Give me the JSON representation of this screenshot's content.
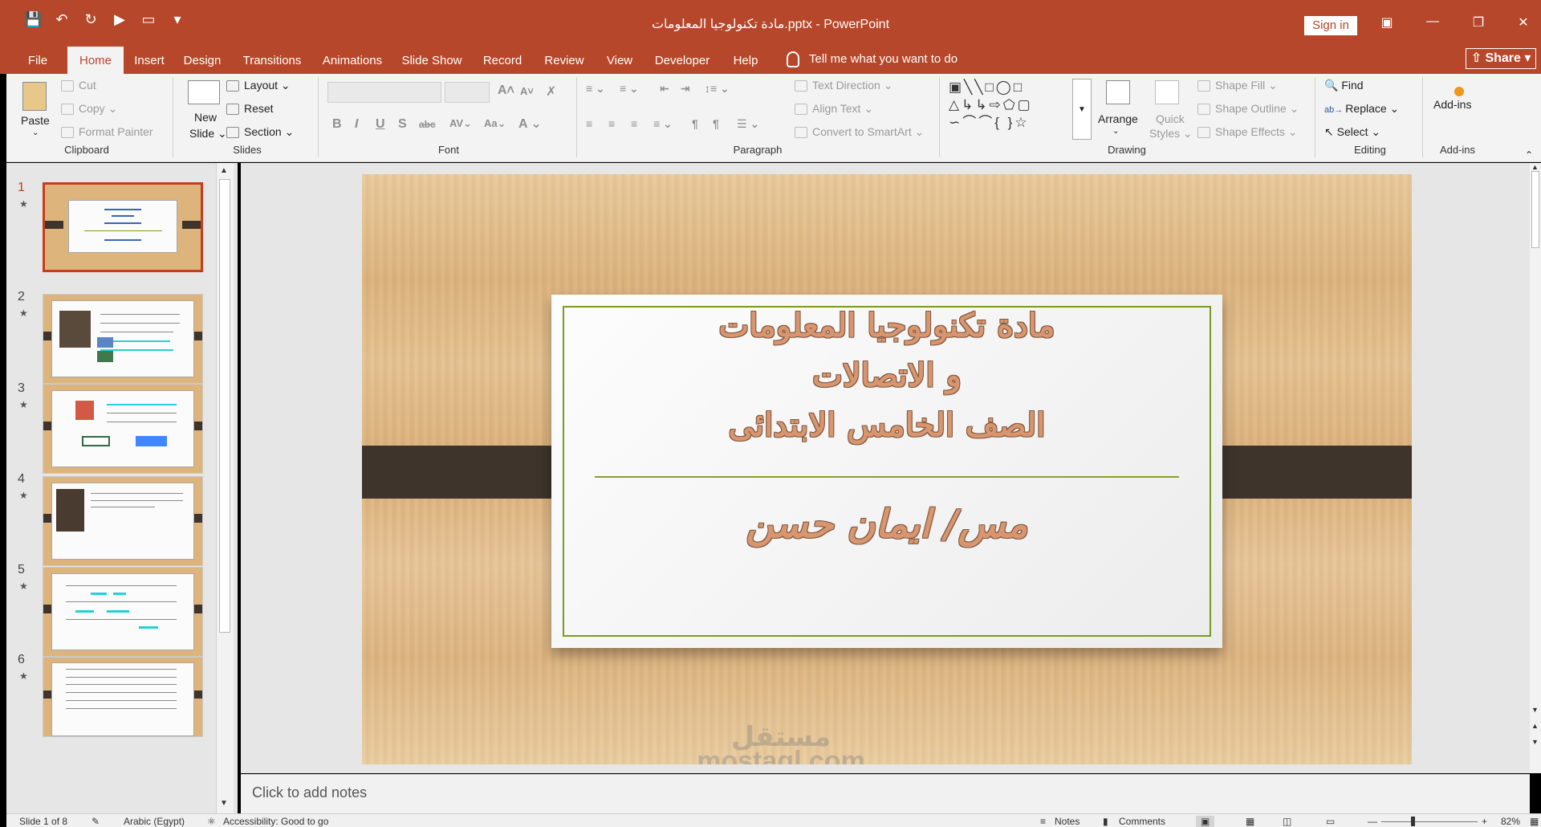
{
  "window": {
    "title": "مادة تكنولوجيا المعلومات.pptx  -  PowerPoint",
    "sign_in": "Sign in",
    "share": "Share"
  },
  "tabs": [
    {
      "label": "File"
    },
    {
      "label": "Home"
    },
    {
      "label": "Insert"
    },
    {
      "label": "Design"
    },
    {
      "label": "Transitions"
    },
    {
      "label": "Animations"
    },
    {
      "label": "Slide Show"
    },
    {
      "label": "Record"
    },
    {
      "label": "Review"
    },
    {
      "label": "View"
    },
    {
      "label": "Developer"
    },
    {
      "label": "Help"
    }
  ],
  "active_tab": "Home",
  "tell_me": "Tell me what you want to do",
  "ribbon": {
    "clipboard": {
      "label": "Clipboard",
      "paste": "Paste",
      "cut": "Cut",
      "copy": "Copy",
      "format_painter": "Format Painter"
    },
    "slides": {
      "label": "Slides",
      "new_slide_1": "New",
      "new_slide_2": "Slide",
      "layout": "Layout",
      "reset": "Reset",
      "section": "Section"
    },
    "font": {
      "label": "Font"
    },
    "paragraph": {
      "label": "Paragraph",
      "text_direction": "Text Direction",
      "align_text": "Align Text",
      "convert_smartart": "Convert to SmartArt"
    },
    "drawing": {
      "label": "Drawing",
      "arrange": "Arrange",
      "quick_styles_1": "Quick",
      "quick_styles_2": "Styles",
      "shape_fill": "Shape Fill",
      "shape_outline": "Shape Outline",
      "shape_effects": "Shape Effects"
    },
    "editing": {
      "label": "Editing",
      "find": "Find",
      "replace": "Replace",
      "select": "Select"
    },
    "addins": {
      "label": "Add-ins",
      "button": "Add-ins"
    }
  },
  "thumbnails": [
    {
      "number": "1",
      "star": "★"
    },
    {
      "number": "2",
      "star": "★"
    },
    {
      "number": "3",
      "star": "★"
    },
    {
      "number": "4",
      "star": "★"
    },
    {
      "number": "5",
      "star": "★"
    },
    {
      "number": "6",
      "star": "★"
    }
  ],
  "slide": {
    "title_line1": "مادة تكنولوجيا المعلومات",
    "title_line2": "و الاتصالات",
    "title_line3": "الصف الخامس الابتدائى",
    "subtitle": "مس/ ايمان حسن",
    "watermark_1": "مستقل",
    "watermark_2": "mostaql.com"
  },
  "notes_placeholder": "Click to add notes",
  "status": {
    "slide_info": "Slide 1 of 8",
    "language": "Arabic (Egypt)",
    "accessibility": "Accessibility: Good to go",
    "notes": "Notes",
    "comments": "Comments",
    "zoom": "82%"
  }
}
